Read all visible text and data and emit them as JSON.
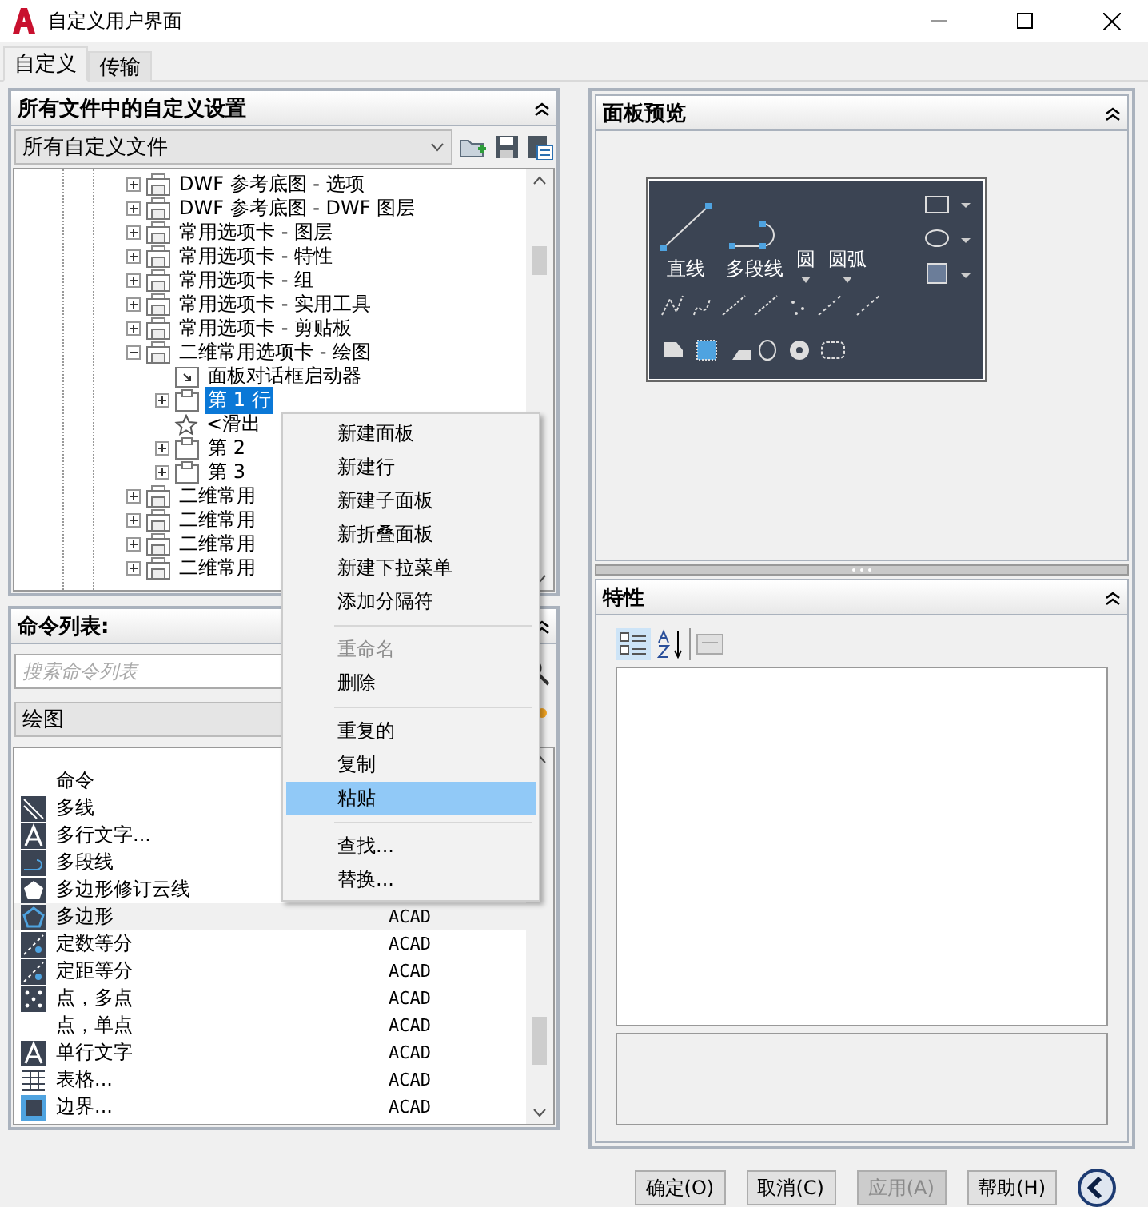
{
  "window": {
    "title": "自定义用户界面"
  },
  "tabs": [
    {
      "label": "自定义",
      "selected": true
    },
    {
      "label": "传输",
      "selected": false
    }
  ],
  "customizations_panel": {
    "title": "所有文件中的自定义设置",
    "file_select": "所有自定义文件",
    "tree": [
      {
        "label": "DWF 参考底图 - 选项",
        "kind": "panel",
        "expanded": false
      },
      {
        "label": "DWF 参考底图 - DWF 图层",
        "kind": "panel",
        "expanded": false
      },
      {
        "label": "常用选项卡 - 图层",
        "kind": "panel",
        "expanded": false
      },
      {
        "label": "常用选项卡 - 特性",
        "kind": "panel",
        "expanded": false
      },
      {
        "label": "常用选项卡 - 组",
        "kind": "panel",
        "expanded": false
      },
      {
        "label": "常用选项卡 - 实用工具",
        "kind": "panel",
        "expanded": false
      },
      {
        "label": "常用选项卡 - 剪贴板",
        "kind": "panel",
        "expanded": false
      },
      {
        "label": "二维常用选项卡 - 绘图",
        "kind": "panel",
        "expanded": true,
        "children": [
          {
            "label": "面板对话框启动器",
            "kind": "launcher",
            "selected": false
          },
          {
            "label": "第 1 行",
            "kind": "row",
            "expanded": false,
            "selected": true
          },
          {
            "label": "<滑出",
            "kind": "slideout",
            "selected": false
          },
          {
            "label": "第 2",
            "kind": "row",
            "expanded": false,
            "selected": false
          },
          {
            "label": "第 3",
            "kind": "row",
            "expanded": false,
            "selected": false
          }
        ]
      },
      {
        "label": "二维常用",
        "kind": "panel",
        "expanded": false
      },
      {
        "label": "二维常用",
        "kind": "panel",
        "expanded": false
      },
      {
        "label": "二维常用",
        "kind": "panel",
        "expanded": false
      },
      {
        "label": "二维常用",
        "kind": "panel",
        "expanded": false
      }
    ]
  },
  "command_panel": {
    "title": "命令列表:",
    "search": {
      "placeholder": "搜索命令列表"
    },
    "category": "绘图",
    "column_1": "命令",
    "rows": [
      {
        "name": "多线",
        "kind": "multiline",
        "selected": false
      },
      {
        "name": "多行文字...",
        "kind": "text",
        "selected": false
      },
      {
        "name": "多段线",
        "kind": "polyline",
        "selected": false
      },
      {
        "name": "多边形修订云线",
        "kind": "revcloud",
        "selected": false
      },
      {
        "name": "多边形",
        "kind": "polygon",
        "source": "ACAD",
        "selected": true
      },
      {
        "name": "定数等分",
        "kind": "divide",
        "source": "ACAD",
        "selected": false
      },
      {
        "name": "定距等分",
        "kind": "divide",
        "source": "ACAD",
        "selected": false
      },
      {
        "name": "点，多点",
        "kind": "points",
        "source": "ACAD",
        "selected": false
      },
      {
        "name": "点，单点",
        "kind": "plain",
        "source": "ACAD",
        "selected": false
      },
      {
        "name": "单行文字",
        "kind": "text",
        "source": "ACAD",
        "selected": false
      },
      {
        "name": "表格...",
        "kind": "table",
        "source": "ACAD",
        "selected": false
      },
      {
        "name": "边界...",
        "kind": "boundary",
        "source": "ACAD",
        "selected": false
      }
    ]
  },
  "context_menu": [
    {
      "kind": "item",
      "label": "新建面板",
      "disabled": false,
      "selected": false
    },
    {
      "kind": "item",
      "label": "新建行",
      "disabled": false,
      "selected": false
    },
    {
      "kind": "item",
      "label": "新建子面板",
      "disabled": false,
      "selected": false
    },
    {
      "kind": "item",
      "label": "新折叠面板",
      "disabled": false,
      "selected": false
    },
    {
      "kind": "item",
      "label": "新建下拉菜单",
      "disabled": false,
      "selected": false
    },
    {
      "kind": "item",
      "label": "添加分隔符",
      "disabled": false,
      "selected": false
    },
    {
      "kind": "separator"
    },
    {
      "kind": "item",
      "label": "重命名",
      "disabled": true,
      "selected": false
    },
    {
      "kind": "item",
      "label": "删除",
      "disabled": false,
      "selected": false
    },
    {
      "kind": "separator"
    },
    {
      "kind": "item",
      "label": "重复的",
      "disabled": false,
      "selected": false
    },
    {
      "kind": "item",
      "label": "复制",
      "disabled": false,
      "selected": false
    },
    {
      "kind": "item",
      "label": "粘贴",
      "disabled": false,
      "selected": true
    },
    {
      "kind": "separator"
    },
    {
      "kind": "item",
      "label": "查找...",
      "disabled": false,
      "selected": false
    },
    {
      "kind": "item",
      "label": "替换...",
      "disabled": false,
      "selected": false
    }
  ],
  "preview_panel": {
    "title": "面板预览",
    "large_buttons": [
      {
        "label": "直线",
        "kind": "line"
      },
      {
        "label": "多段线",
        "kind": "polyline"
      },
      {
        "label": "圆",
        "kind": "split"
      },
      {
        "label": "圆弧",
        "kind": "split"
      }
    ]
  },
  "properties_panel": {
    "title": "特性"
  },
  "buttons": [
    {
      "label": "确定(O)",
      "disabled": false
    },
    {
      "label": "取消(C)",
      "disabled": false
    },
    {
      "label": "应用(A)",
      "disabled": true
    },
    {
      "label": "帮助(H)",
      "disabled": false
    }
  ]
}
